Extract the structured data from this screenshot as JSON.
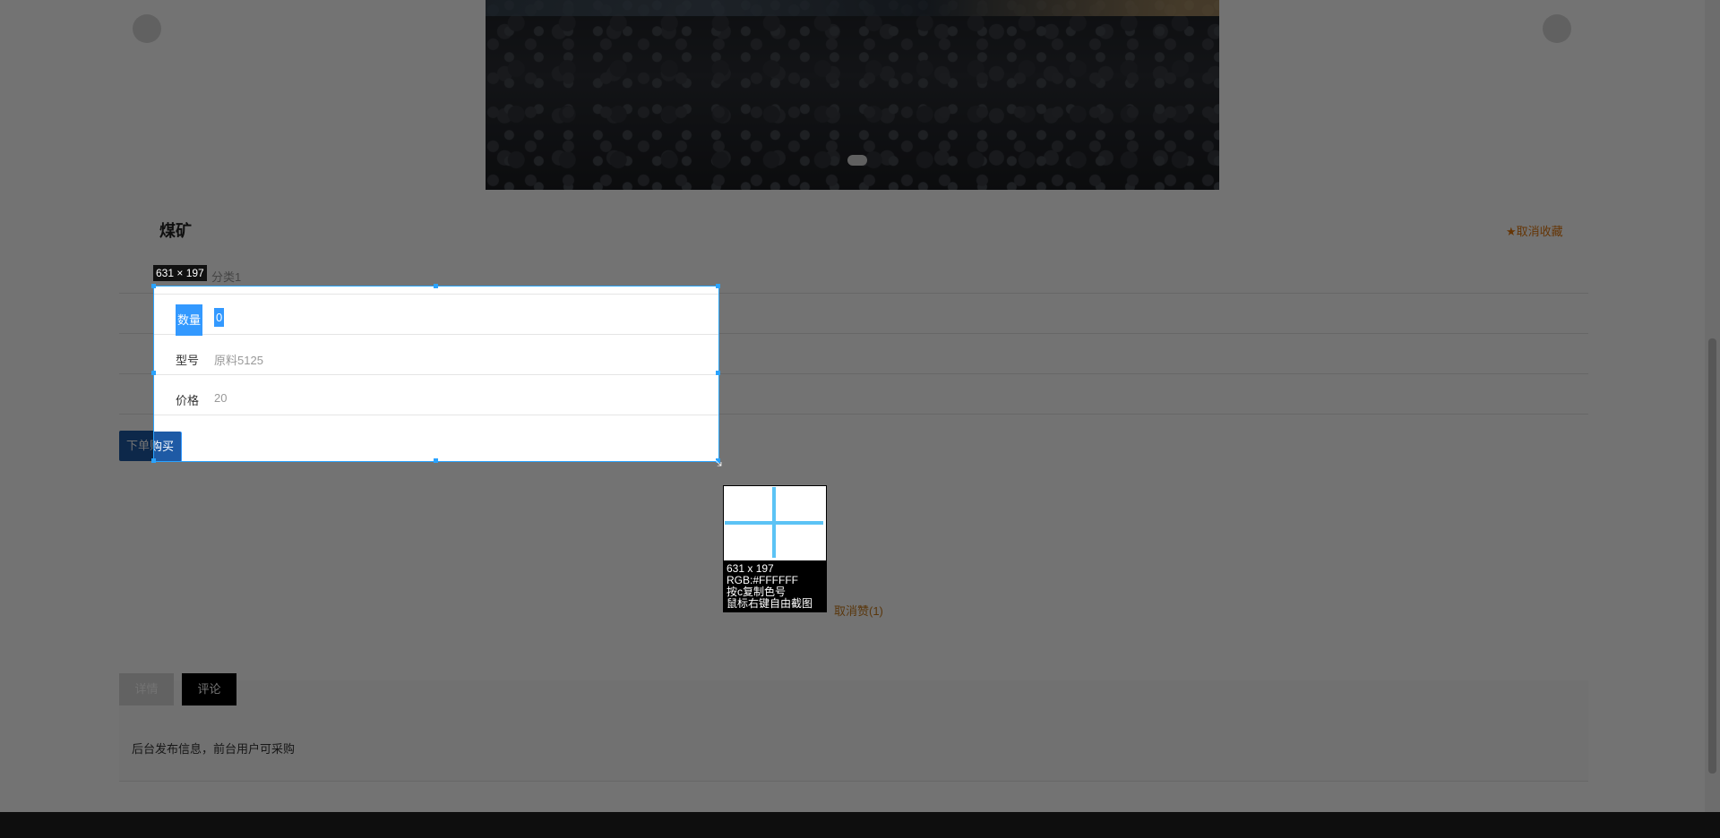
{
  "product": {
    "title": "煤矿",
    "favorite_label": "★取消收藏",
    "category": "分类1",
    "fields": [
      {
        "label": "数量",
        "value": "0"
      },
      {
        "label": "型号",
        "value": "原料5125"
      },
      {
        "label": "价格",
        "value": "20"
      }
    ],
    "buy_label": "下单购买",
    "like_label": "取消赞(1)"
  },
  "tabs": [
    {
      "label": "详情"
    },
    {
      "label": "评论"
    }
  ],
  "content": {
    "text": "后台发布信息，前台用户可采购"
  },
  "screenshot_tool": {
    "size_badge": "631 × 197",
    "info": {
      "size": "631 x 197",
      "rgb": "RGB:#FFFFFF",
      "hint_copy": "按c复制色号",
      "hint_crop": "鼠标右键自由截图"
    },
    "colors": {
      "selection_border": "#2aa3ff",
      "crosshair": "#5cc3f5"
    }
  }
}
